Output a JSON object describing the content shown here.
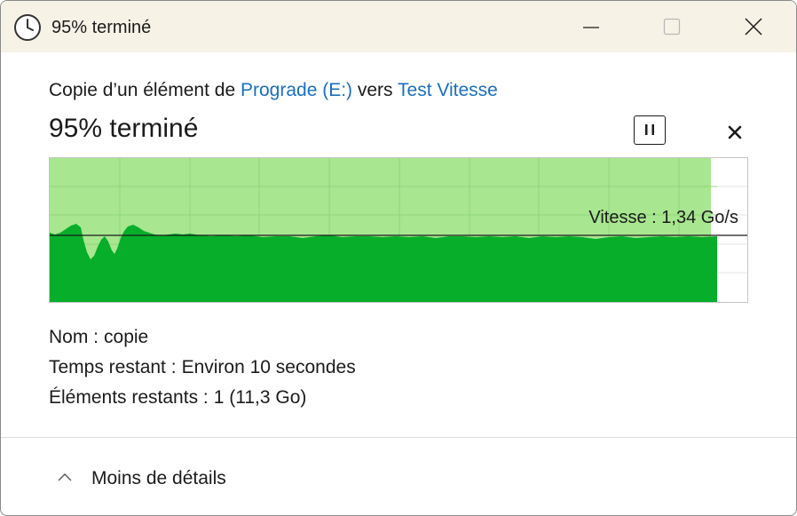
{
  "window": {
    "title": "95% terminé",
    "icon": "clock-icon",
    "controls": {
      "minimize": "minimize-icon",
      "maximize": "maximize-icon",
      "close": "close-icon"
    }
  },
  "copy": {
    "prefix": "Copie d’un élément de ",
    "source": "Prograde (E:)",
    "middle": " vers ",
    "destination": "Test Vitesse",
    "progress_text": "95% terminé",
    "progress_fraction": 0.95
  },
  "graph": {
    "speed_label": "Vitesse : 1,34 Go/s",
    "colors": {
      "fill": "#06ae2a",
      "background_fill": "#a8e690",
      "grid": "#8fd67a",
      "speed_line": "#1b1b1b"
    }
  },
  "details": {
    "name_label": "Nom :",
    "name_value": "copie",
    "time_label": "Temps restant :",
    "time_value": "Environ 10 secondes",
    "items_label": "Éléments restants :",
    "items_value": "1 (11,3 Go)"
  },
  "footer": {
    "toggle_label": "Moins de détails",
    "toggle_icon": "chevron-up-icon"
  },
  "buttons": {
    "pause": "pause-icon",
    "cancel": "cancel-icon"
  }
}
